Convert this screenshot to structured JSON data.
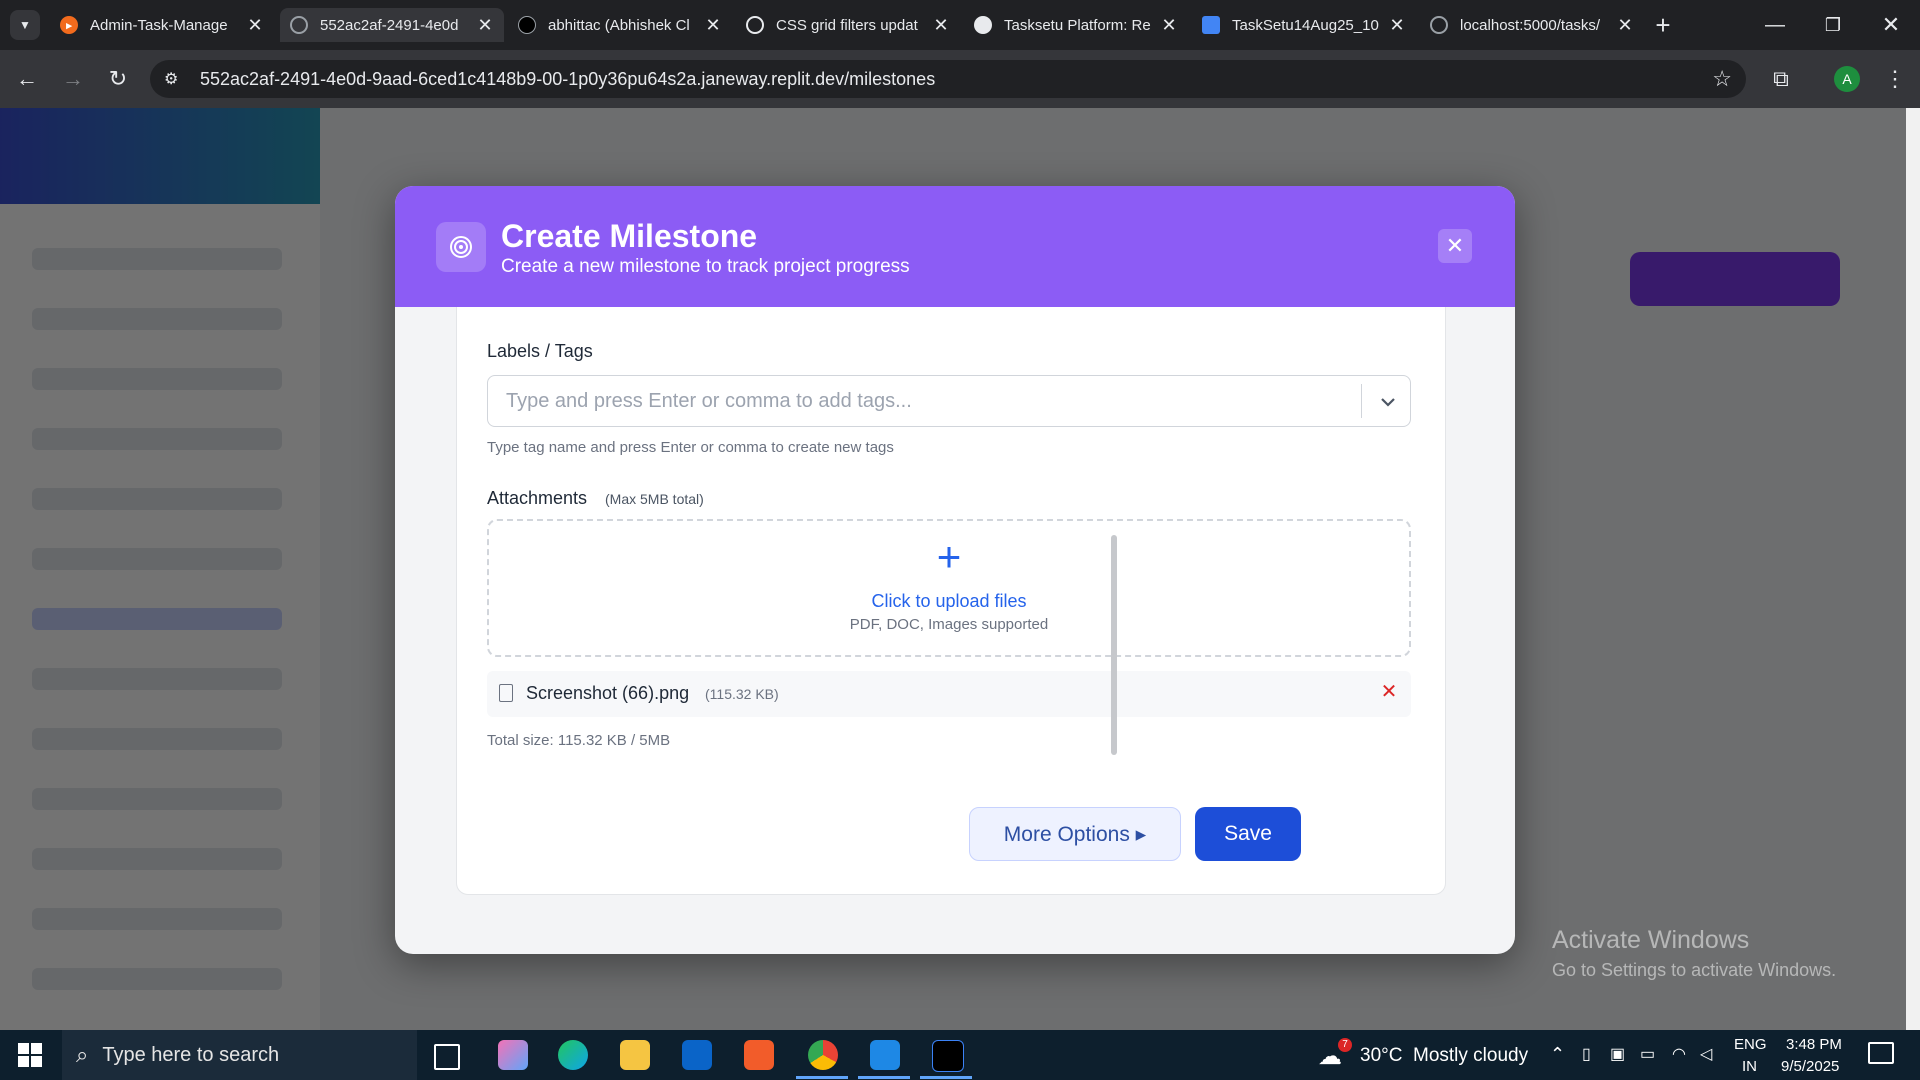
{
  "browser": {
    "tabs": [
      {
        "title": "Admin-Task-Manage",
        "active": false
      },
      {
        "title": "552ac2af-2491-4e0d",
        "active": true
      },
      {
        "title": "abhittac (Abhishek Cl",
        "active": false
      },
      {
        "title": "CSS grid filters updat",
        "active": false
      },
      {
        "title": "Tasksetu Platform: Re",
        "active": false
      },
      {
        "title": "TaskSetu14Aug25_10",
        "active": false
      },
      {
        "title": "localhost:5000/tasks/",
        "active": false
      }
    ],
    "url": "552ac2af-2491-4e0d-9aad-6ced1c4148b9-00-1p0y36pu64s2a.janeway.replit.dev/milestones",
    "profile_initial": "A"
  },
  "modal": {
    "title": "Create Milestone",
    "subtitle": "Create a new milestone to track project progress",
    "close_glyph": "✕",
    "tags": {
      "label": "Labels / Tags",
      "placeholder": "Type and press Enter or comma to add tags...",
      "help": "Type tag name and press Enter or comma to create new tags"
    },
    "attachments": {
      "label": "Attachments",
      "max_note": "(Max 5MB total)",
      "upload_text": "Click to upload files",
      "upload_sub": "PDF, DOC, Images supported",
      "files": [
        {
          "name": "Screenshot (66).png",
          "size": "(115.32 KB)"
        }
      ],
      "total": "Total size: 115.32 KB / 5MB"
    },
    "more_options_label": "More Options ▸",
    "save_label": "Save"
  },
  "watermark": {
    "line1": "Activate Windows",
    "line2": "Go to Settings to activate Windows."
  },
  "taskbar": {
    "search_placeholder": "Type here to search",
    "weather": "30°C  Mostly cloudy",
    "weather_badge": "7",
    "lang_top": "ENG",
    "lang_bottom": "IN",
    "time": "3:48 PM",
    "date": "9/5/2025"
  },
  "colors": {
    "modal_header": "#8c5cf5",
    "primary_button": "#1d4ed8",
    "link_blue": "#2563eb",
    "remove_red": "#dc2626"
  }
}
